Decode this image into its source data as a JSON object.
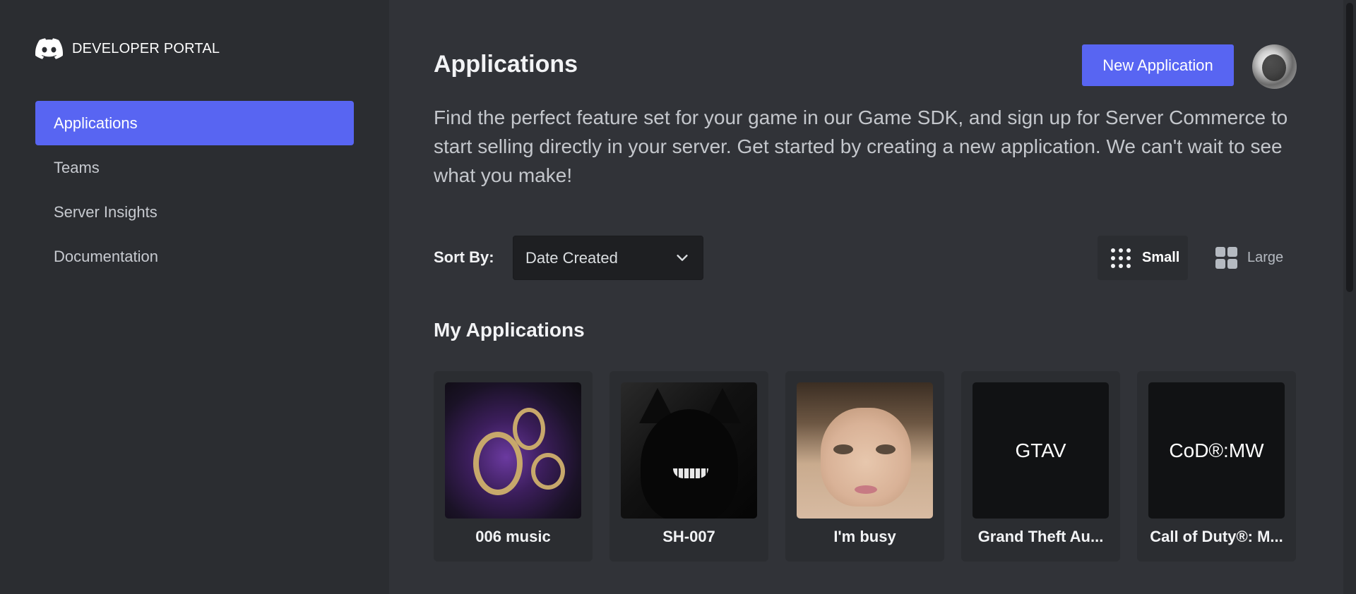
{
  "brand": {
    "portal_label": "DEVELOPER PORTAL"
  },
  "sidebar": {
    "items": [
      {
        "label": "Applications",
        "active": true
      },
      {
        "label": "Teams",
        "active": false
      },
      {
        "label": "Server Insights",
        "active": false
      },
      {
        "label": "Documentation",
        "active": false
      }
    ]
  },
  "header": {
    "title": "Applications",
    "new_button": "New Application"
  },
  "description": "Find the perfect feature set for your game in our Game SDK, and sign up for Server Commerce to start selling directly in your server. Get started by creating a new application. We can't wait to see what you make!",
  "sort": {
    "label": "Sort By:",
    "value": "Date Created"
  },
  "view": {
    "small": "Small",
    "large": "Large",
    "selected": "Small"
  },
  "section_title": "My Applications",
  "apps": [
    {
      "name": "006 music",
      "icon": "music-art-image"
    },
    {
      "name": "SH-007",
      "icon": "black-cat-image"
    },
    {
      "name": "I'm busy",
      "icon": "cat-face-image"
    },
    {
      "name": "Grand Theft Au...",
      "icon_text": "GTAV"
    },
    {
      "name": "Call of Duty®: M...",
      "icon_text": "CoD®:MW"
    }
  ],
  "colors": {
    "accent": "#5865f2",
    "background": "#313338",
    "sidebar": "#2b2d31"
  }
}
